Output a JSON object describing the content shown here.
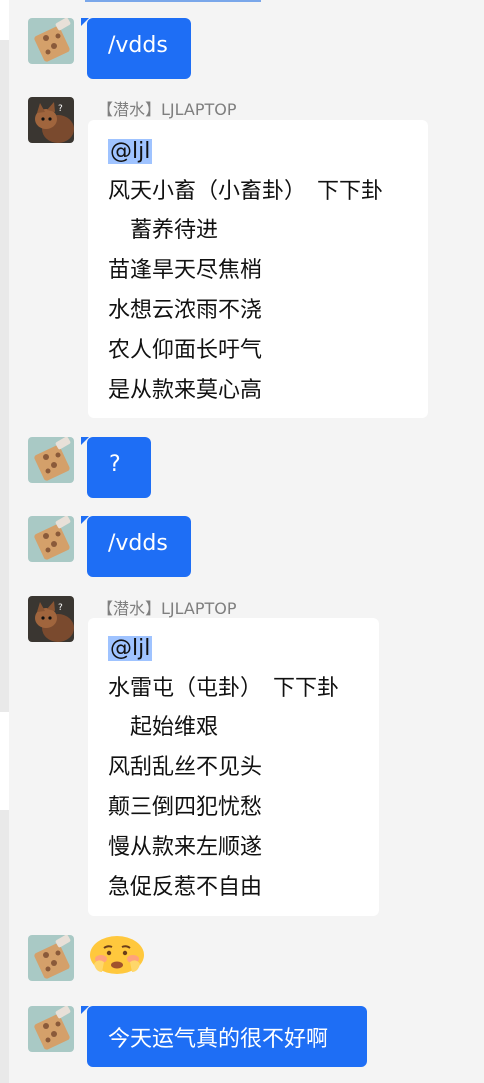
{
  "messages": [
    {
      "type": "outgoing",
      "text": "/vdds"
    },
    {
      "type": "incoming",
      "sender": "【潜水】LJLAPTOP",
      "mention": "@ljl",
      "lines": [
        "风天小畜（小畜卦）　下下卦",
        "　蓄养待进",
        "苗逢旱天尽焦梢",
        "水想云浓雨不浇",
        "农人仰面长吁气",
        "是从款来莫心高"
      ]
    },
    {
      "type": "outgoing",
      "text": "?"
    },
    {
      "type": "outgoing",
      "text": "/vdds"
    },
    {
      "type": "incoming",
      "sender": "【潜水】LJLAPTOP",
      "mention": "@ljl",
      "lines": [
        "水雷屯（屯卦）　下下卦",
        "　起始维艰",
        "风刮乱丝不见头",
        "颠三倒四犯忧愁",
        "慢从款来左顺遂",
        "急促反惹不自由"
      ]
    },
    {
      "type": "outgoing-emoji",
      "emoji": "worried-face-emoji"
    },
    {
      "type": "outgoing",
      "text": "今天运气真的很不好啊"
    }
  ],
  "colors": {
    "outgoing_bubble": "#1e6ef5",
    "incoming_bubble": "#ffffff",
    "background": "#f4f4f4",
    "mention_highlight": "#9fc3ff"
  }
}
